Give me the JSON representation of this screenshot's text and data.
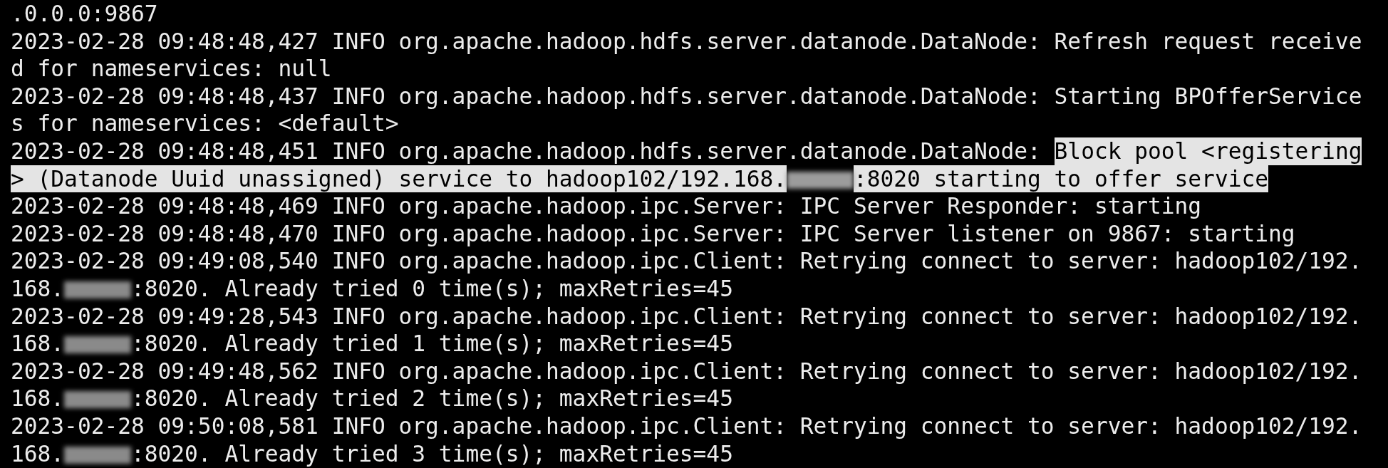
{
  "terminal": {
    "lines": [
      {
        "segments": [
          {
            "kind": "text",
            "text": ".0.0.0:9867",
            "selected": false
          }
        ]
      },
      {
        "segments": [
          {
            "kind": "text",
            "text": "2023-02-28 09:48:48,427 INFO org.apache.hadoop.hdfs.server.datanode.DataNode: Refresh request receive",
            "selected": false
          }
        ]
      },
      {
        "segments": [
          {
            "kind": "text",
            "text": "d for nameservices: null",
            "selected": false
          }
        ]
      },
      {
        "segments": [
          {
            "kind": "text",
            "text": "2023-02-28 09:48:48,437 INFO org.apache.hadoop.hdfs.server.datanode.DataNode: Starting BPOfferService",
            "selected": false
          }
        ]
      },
      {
        "segments": [
          {
            "kind": "text",
            "text": "s for nameservices: <default>",
            "selected": false
          }
        ]
      },
      {
        "segments": [
          {
            "kind": "text",
            "text": "2023-02-28 09:48:48,451 INFO org.apache.hadoop.hdfs.server.datanode.DataNode: ",
            "selected": false
          },
          {
            "kind": "text",
            "text": "Block pool <registering",
            "selected": true
          }
        ]
      },
      {
        "segments": [
          {
            "kind": "text",
            "text": "> (Datanode Uuid unassigned) service to hadoop102/192.168.",
            "selected": true
          },
          {
            "kind": "redacted",
            "selected": true
          },
          {
            "kind": "text",
            "text": ":8020 starting to offer service",
            "selected": true
          }
        ]
      },
      {
        "segments": [
          {
            "kind": "text",
            "text": "2023-02-28 09:48:48,469 INFO org.apache.hadoop.ipc.Server: IPC Server Responder: starting",
            "selected": false
          }
        ]
      },
      {
        "segments": [
          {
            "kind": "text",
            "text": "2023-02-28 09:48:48,470 INFO org.apache.hadoop.ipc.Server: IPC Server listener on 9867: starting",
            "selected": false
          }
        ]
      },
      {
        "segments": [
          {
            "kind": "text",
            "text": "2023-02-28 09:49:08,540 INFO org.apache.hadoop.ipc.Client: Retrying connect to server: hadoop102/192.",
            "selected": false
          }
        ]
      },
      {
        "segments": [
          {
            "kind": "text",
            "text": "168.",
            "selected": false
          },
          {
            "kind": "redacted",
            "selected": false
          },
          {
            "kind": "text",
            "text": ":8020. Already tried 0 time(s); maxRetries=45",
            "selected": false
          }
        ]
      },
      {
        "segments": [
          {
            "kind": "text",
            "text": "2023-02-28 09:49:28,543 INFO org.apache.hadoop.ipc.Client: Retrying connect to server: hadoop102/192.",
            "selected": false
          }
        ]
      },
      {
        "segments": [
          {
            "kind": "text",
            "text": "168.",
            "selected": false
          },
          {
            "kind": "redacted",
            "selected": false
          },
          {
            "kind": "text",
            "text": ":8020. Already tried 1 time(s); maxRetries=45",
            "selected": false
          }
        ]
      },
      {
        "segments": [
          {
            "kind": "text",
            "text": "2023-02-28 09:49:48,562 INFO org.apache.hadoop.ipc.Client: Retrying connect to server: hadoop102/192.",
            "selected": false
          }
        ]
      },
      {
        "segments": [
          {
            "kind": "text",
            "text": "168.",
            "selected": false
          },
          {
            "kind": "redacted",
            "selected": false
          },
          {
            "kind": "text",
            "text": ":8020. Already tried 2 time(s); maxRetries=45",
            "selected": false
          }
        ]
      },
      {
        "segments": [
          {
            "kind": "text",
            "text": "2023-02-28 09:50:08,581 INFO org.apache.hadoop.ipc.Client: Retrying connect to server: hadoop102/192.",
            "selected": false
          }
        ]
      },
      {
        "segments": [
          {
            "kind": "text",
            "text": "168.",
            "selected": false
          },
          {
            "kind": "redacted",
            "selected": false
          },
          {
            "kind": "text",
            "text": ":8020. Already tried 3 time(s); maxRetries=45",
            "selected": false
          }
        ]
      }
    ]
  }
}
